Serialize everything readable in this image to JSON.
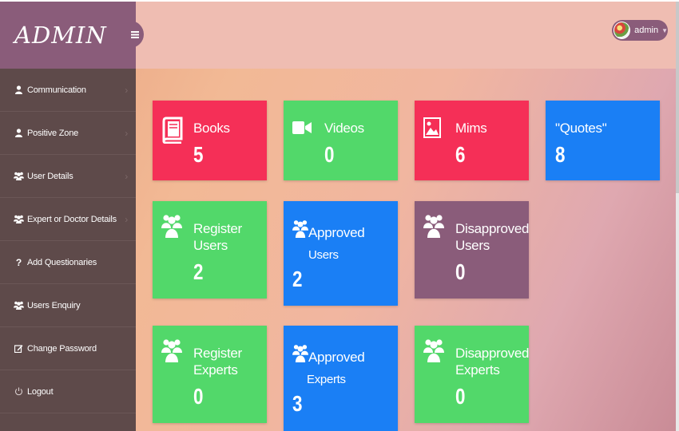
{
  "brand": {
    "title": "ADMIN"
  },
  "header": {
    "toggle_icon": "hamburger-icon",
    "user_name": "admin"
  },
  "sidebar": {
    "items": [
      {
        "label": "Communication",
        "icon": "user-icon"
      },
      {
        "label": "Positive Zone",
        "icon": "user-icon"
      },
      {
        "label": "User Details",
        "icon": "users-icon"
      },
      {
        "label": "Expert or Doctor Details",
        "icon": "users-icon"
      },
      {
        "label": "Add Questionaries",
        "icon": "question-icon"
      },
      {
        "label": "Users Enquiry",
        "icon": "users-icon"
      },
      {
        "label": "Change Password",
        "icon": "edit-icon"
      },
      {
        "label": "Logout",
        "icon": "power-icon"
      }
    ]
  },
  "tiles": {
    "books": {
      "label": "Books",
      "value": "5",
      "icon": "book-icon"
    },
    "videos": {
      "label": "Videos",
      "value": "0",
      "icon": "video-camera-icon"
    },
    "mims": {
      "label": "Mims",
      "value": "6",
      "icon": "image-icon"
    },
    "quotes": {
      "label": "\"Quotes\"",
      "value": "8"
    },
    "register_users": {
      "label_1": "Register",
      "label_2": "Users",
      "value": "2",
      "icon": "users-icon"
    },
    "approved_users": {
      "label_1": "Approved",
      "label_2": "Users",
      "value": "2",
      "icon": "users-icon"
    },
    "disapproved_users": {
      "label_1": "Disapproved",
      "label_2": "Users",
      "value": "0",
      "icon": "users-icon"
    },
    "register_experts": {
      "label_1": "Register",
      "label_2": "Experts",
      "value": "0",
      "icon": "users-icon"
    },
    "approved_experts": {
      "label_1": "Approved",
      "label_2": "Experts",
      "value": "3",
      "icon": "users-icon"
    },
    "disapproved_experts": {
      "label_1": "Disapproved",
      "label_2": "Experts",
      "value": "0",
      "icon": "users-icon"
    }
  },
  "colors": {
    "brand": "#8a5c7a",
    "sidebar": "#5e4a4a",
    "tile_red": "#f52f57",
    "tile_green": "#52d86a",
    "tile_blue": "#1a7ff5",
    "tile_purple": "#8a5c7a"
  }
}
